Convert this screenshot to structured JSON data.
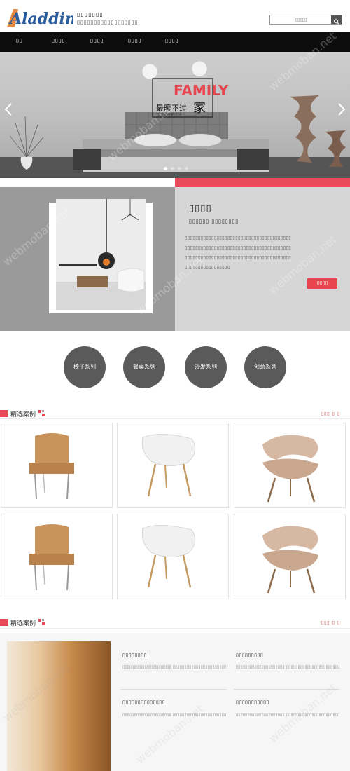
{
  "header": {
    "logo_text": "Aladdin",
    "tagline_1": "▯▯▯▯▯▯▯",
    "tagline_2": "▯▯▯▯▯▯▯▯▯▯▯▯▯▯▯▯▯▯",
    "search_placeholder": "▯▯▯▯▯"
  },
  "nav": {
    "items": [
      {
        "label": "▯▯"
      },
      {
        "label": "▯▯▯▯"
      },
      {
        "label": "▯▯▯▯"
      },
      {
        "label": "▯▯▯▯"
      },
      {
        "label": "▯▯▯▯"
      }
    ]
  },
  "banner": {
    "big_text": "FAMILY",
    "line_1": "最暖不过",
    "line_2": "家",
    "line_3": "YO你心中的生活",
    "dots": 4,
    "active_dot": 1
  },
  "about": {
    "title": "▯▯▯▯",
    "subtitle": "▯▯▯▯▯▯ ▯▯▯▯▯▯▯▯",
    "body_lines": [
      "▯▯▯▯▯▯▯▯▯▯▯▯▯▯▯▯▯▯▯▯▯▯▯▯▯▯▯▯▯▯▯▯▯▯▯▯▯▯▯▯",
      "▯▯▯▯▯▯▯▯▯▯▯▯▯▯▯▯▯▯▯▯▯▯▯▯▯▯▯▯▯▯▯▯▯▯▯▯▯▯▯▯",
      "▯▯▯▯▯▯▯▯▯▯▯▯▯▯▯▯▯▯▯▯▯▯▯▯▯▯▯▯▯▯▯▯▯▯▯▯▯▯▯▯",
      "▯▯▯▯▯▯▯▯▯▯▯▯▯▯▯▯▯"
    ],
    "more_label": "▯▯▯▯"
  },
  "categories": [
    {
      "label": "椅子系列"
    },
    {
      "label": "餐桌系列"
    },
    {
      "label": "沙发系列"
    },
    {
      "label": "创意系列"
    }
  ],
  "products_section": {
    "title": "精选案例",
    "more": "▯▯▯ ▯ ▯"
  },
  "news_section": {
    "title": "精选案例",
    "more": "▯▯▯ ▯ ▯",
    "items": [
      {
        "title": "▯▯▯▯▯▯▯▯",
        "body": "▯▯▯▯▯▯▯▯▯▯▯▯▯▯▯▯▯▯▯▯▯ ▯▯▯▯▯▯▯▯▯▯▯▯▯▯▯▯▯▯▯▯▯▯▯"
      },
      {
        "title": "▯▯▯▯▯▯▯▯▯",
        "body": "▯▯▯▯▯▯▯▯▯▯▯▯▯▯▯▯▯▯▯▯▯ ▯▯▯▯▯▯▯▯▯▯▯▯▯▯▯▯▯▯▯▯▯▯▯"
      },
      {
        "title": "▯▯▯▯▯▯▯▯▯▯▯▯▯▯",
        "body": "▯▯▯▯▯▯▯▯▯▯▯▯▯▯▯▯▯▯▯▯▯ ▯▯▯▯▯▯▯▯▯▯▯▯▯▯▯▯▯▯▯▯▯▯▯"
      },
      {
        "title": "▯▯▯▯▯▯▯▯▯▯▯",
        "body": "▯▯▯▯▯▯▯▯▯▯▯▯▯▯▯▯▯▯▯▯▯ ▯▯▯▯▯▯▯▯▯▯▯▯▯▯▯▯▯▯▯▯▯▯▯"
      }
    ]
  },
  "colors": {
    "accent_red": "#e84a5a",
    "nav_bg": "#0d0d0d",
    "logo_blue": "#2a5d9e"
  },
  "watermark": "webmoban.net"
}
